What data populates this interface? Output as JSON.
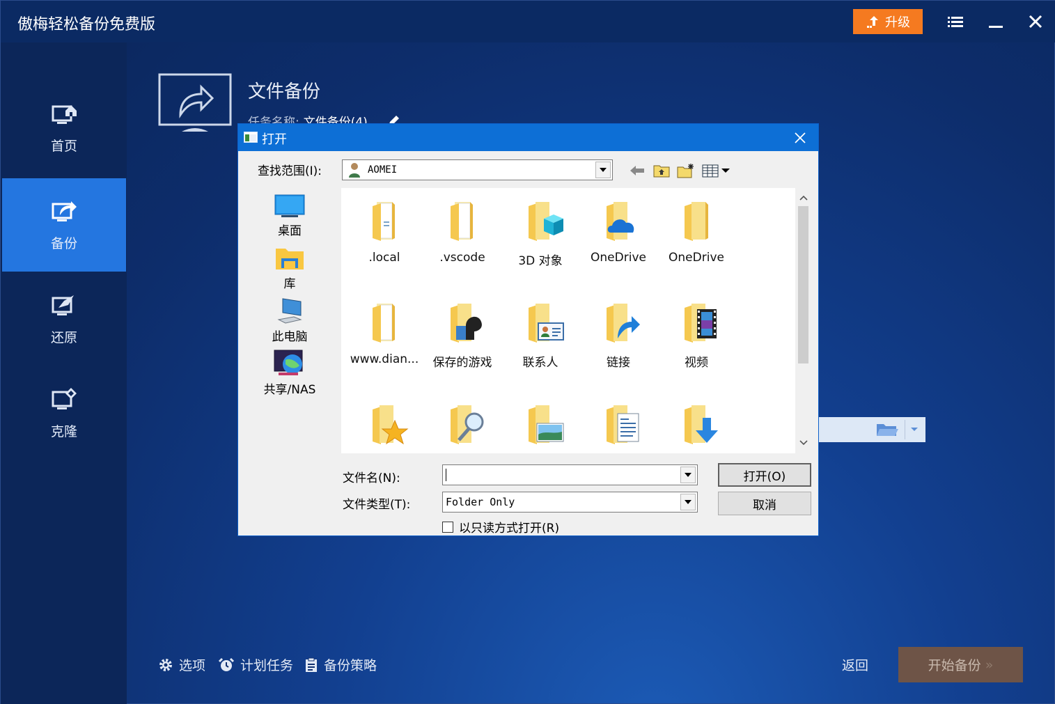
{
  "app": {
    "title": "傲梅轻松备份免费版",
    "upgrade_label": "升级"
  },
  "sidebar": {
    "items": [
      {
        "label": "首页"
      },
      {
        "label": "备份"
      },
      {
        "label": "还原"
      },
      {
        "label": "克隆"
      }
    ]
  },
  "main": {
    "page_title": "文件备份",
    "task_name_label": "任务名称:",
    "task_name_value": "文件备份(4)"
  },
  "bottom": {
    "options_label": "选项",
    "schedule_label": "计划任务",
    "strategy_label": "备份策略",
    "back_label": "返回",
    "start_label": "开始备份",
    "start_arrows": "»"
  },
  "dialog": {
    "title": "打开",
    "lookin_label": "查找范围(I):",
    "lookin_value": "AOMEI",
    "places": [
      {
        "label": "桌面"
      },
      {
        "label": "库"
      },
      {
        "label": "此电脑"
      },
      {
        "label": "共享/NAS"
      }
    ],
    "files": [
      {
        "label": ".local",
        "icon": "folder-doc-icon"
      },
      {
        "label": ".vscode",
        "icon": "folder-doc-icon"
      },
      {
        "label": "3D 对象",
        "icon": "folder-3d-icon"
      },
      {
        "label": "OneDrive",
        "icon": "folder-cloud-icon"
      },
      {
        "label": "OneDrive",
        "icon": "folder-icon"
      },
      {
        "label": "www.dian...",
        "icon": "folder-doc-icon"
      },
      {
        "label": "保存的游戏",
        "icon": "folder-games-icon"
      },
      {
        "label": "联系人",
        "icon": "folder-contacts-icon"
      },
      {
        "label": "链接",
        "icon": "folder-link-icon"
      },
      {
        "label": "视频",
        "icon": "folder-video-icon"
      },
      {
        "label": "",
        "icon": "folder-favorites-icon"
      },
      {
        "label": "",
        "icon": "folder-search-icon"
      },
      {
        "label": "",
        "icon": "folder-pictures-icon"
      },
      {
        "label": "",
        "icon": "folder-documents-icon"
      },
      {
        "label": "",
        "icon": "folder-downloads-icon"
      }
    ],
    "filename_label": "文件名(N):",
    "filename_value": "",
    "filetype_label": "文件类型(T):",
    "filetype_value": "Folder Only",
    "open_label": "打开(O)",
    "cancel_label": "取消",
    "readonly_label": "以只读方式打开(R)"
  },
  "colors": {
    "accent_blue": "#2476e0",
    "upgrade_orange": "#f57a20",
    "start_disabled": "#6e5447",
    "dialog_title": "#0d6fd6"
  }
}
